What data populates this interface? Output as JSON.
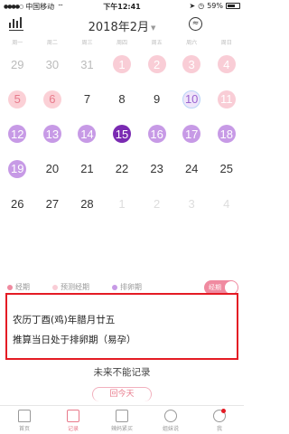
{
  "status_bar": {
    "carrier": "中国移动",
    "time": "下午12:41",
    "battery": "59%"
  },
  "header": {
    "month": "2018年2月"
  },
  "weekdays": [
    "周一",
    "周二",
    "周三",
    "周四",
    "周五",
    "周六",
    "周日"
  ],
  "calendar": [
    [
      {
        "d": "29",
        "t": "other"
      },
      {
        "d": "30",
        "t": "other"
      },
      {
        "d": "31",
        "t": "other"
      },
      {
        "d": "1",
        "t": "predict"
      },
      {
        "d": "2",
        "t": "predict"
      },
      {
        "d": "3",
        "t": "predict"
      },
      {
        "d": "4",
        "t": "predict"
      }
    ],
    [
      {
        "d": "5",
        "t": "period-light"
      },
      {
        "d": "6",
        "t": "period-light"
      },
      {
        "d": "7",
        "t": "normal"
      },
      {
        "d": "8",
        "t": "normal"
      },
      {
        "d": "9",
        "t": "normal"
      },
      {
        "d": "10",
        "t": "ring"
      },
      {
        "d": "11",
        "t": "ovu-light"
      }
    ],
    [
      {
        "d": "12",
        "t": "ovu"
      },
      {
        "d": "13",
        "t": "ovu"
      },
      {
        "d": "14",
        "t": "ovu"
      },
      {
        "d": "15",
        "t": "ovu-today"
      },
      {
        "d": "16",
        "t": "ovu"
      },
      {
        "d": "17",
        "t": "ovu"
      },
      {
        "d": "18",
        "t": "ovu"
      }
    ],
    [
      {
        "d": "19",
        "t": "ovu"
      },
      {
        "d": "20",
        "t": "normal"
      },
      {
        "d": "21",
        "t": "normal"
      },
      {
        "d": "22",
        "t": "normal"
      },
      {
        "d": "23",
        "t": "normal"
      },
      {
        "d": "24",
        "t": "normal"
      },
      {
        "d": "25",
        "t": "normal"
      }
    ],
    [
      {
        "d": "26",
        "t": "normal"
      },
      {
        "d": "27",
        "t": "normal"
      },
      {
        "d": "28",
        "t": "normal"
      },
      {
        "d": "1",
        "t": "future"
      },
      {
        "d": "2",
        "t": "future"
      },
      {
        "d": "3",
        "t": "future"
      },
      {
        "d": "4",
        "t": "future"
      }
    ],
    [
      {
        "d": "",
        "t": "empty"
      },
      {
        "d": "",
        "t": "empty"
      },
      {
        "d": "",
        "t": "empty"
      },
      {
        "d": "",
        "t": "empty"
      },
      {
        "d": "",
        "t": "empty"
      },
      {
        "d": "",
        "t": "empty"
      },
      {
        "d": "",
        "t": "empty"
      }
    ]
  ],
  "legend": {
    "period": "经期",
    "predicted_period": "预测经期",
    "ovulation": "排卵期",
    "toggle_label": "经期",
    "colors": {
      "period": "#f08aa0",
      "predicted": "#f9cdd6",
      "ovulation": "#c79ae6"
    }
  },
  "info": {
    "lunar_date": "农历丁酉(鸡)年腊月廿五",
    "status": "推算当日处于排卵期（易孕）"
  },
  "future_note": "未来不能记录",
  "today_button": "回今天",
  "tabs": [
    {
      "label": "首页",
      "icon": "home-icon"
    },
    {
      "label": "记录",
      "icon": "calendar-icon"
    },
    {
      "label": "辣妈紧买",
      "icon": "shop-icon"
    },
    {
      "label": "姐妹说",
      "icon": "community-icon"
    },
    {
      "label": "我",
      "icon": "profile-icon"
    }
  ]
}
